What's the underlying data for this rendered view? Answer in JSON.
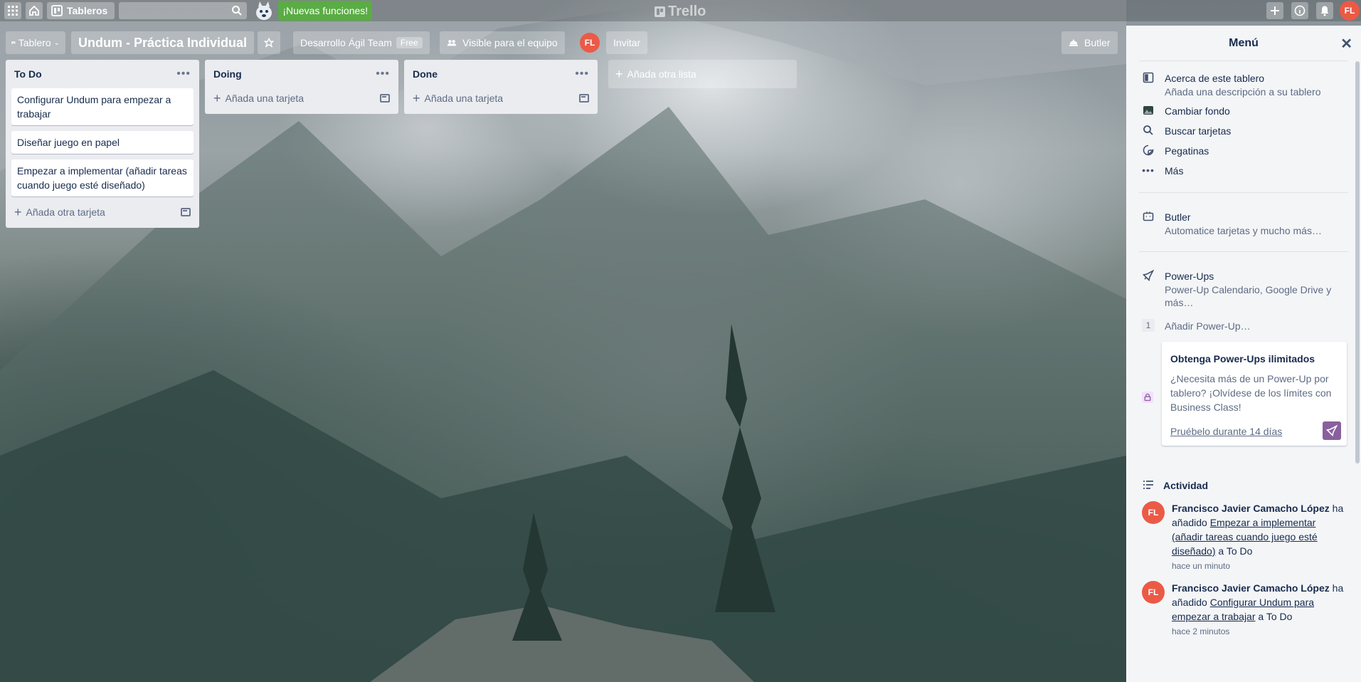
{
  "topbar": {
    "boards_label": "Tableros",
    "new_features": "¡Nuevas funciones!",
    "logo": "Trello",
    "user_initials": "FL"
  },
  "board": {
    "view_label": "Tablero",
    "title": "Undum - Práctica Individual",
    "team": "Desarrollo Ágil Team",
    "team_badge": "Free",
    "visibility": "Visible para el equipo",
    "member_initials": "FL",
    "invite": "Invitar",
    "butler": "Butler"
  },
  "lists": [
    {
      "title": "To Do",
      "cards": [
        "Configurar Undum para empezar a trabajar",
        "Diseñar juego en papel",
        "Empezar a implementar (añadir tareas cuando juego esté diseñado)"
      ],
      "add_label": "Añada otra tarjeta"
    },
    {
      "title": "Doing",
      "cards": [],
      "add_label": "Añada una tarjeta"
    },
    {
      "title": "Done",
      "cards": [],
      "add_label": "Añada una tarjeta"
    }
  ],
  "add_list_label": "Añada otra lista",
  "menu": {
    "title": "Menú",
    "items": [
      {
        "title": "Acerca de este tablero",
        "sub": "Añada una descripción a su tablero"
      },
      {
        "title": "Cambiar fondo"
      },
      {
        "title": "Buscar tarjetas"
      },
      {
        "title": "Pegatinas"
      },
      {
        "title": "Más"
      }
    ],
    "butler": {
      "title": "Butler",
      "sub": "Automatice tarjetas y mucho más…"
    },
    "powerups": {
      "title": "Power-Ups",
      "sub": "Power-Up Calendario, Google Drive y más…"
    },
    "add_powerup_count": "1",
    "add_powerup": "Añadir Power-Up…",
    "promo": {
      "title": "Obtenga Power-Ups ilimitados",
      "body": "¿Necesita más de un Power-Up por tablero? ¡Olvídese de los límites con Business Class!",
      "link": "Pruébelo durante 14 días"
    },
    "activity_title": "Actividad",
    "activity": [
      {
        "initials": "FL",
        "user": "Francisco Javier Camacho López",
        "verb": " ha añadido ",
        "card": "Empezar a implementar (añadir tareas cuando juego esté diseñado)",
        "dest": " a To Do",
        "time": "hace un minuto"
      },
      {
        "initials": "FL",
        "user": "Francisco Javier Camacho López",
        "verb": " ha añadido ",
        "card": "Configurar Undum para empezar a trabajar",
        "dest": " a To Do",
        "time": "hace 2 minutos"
      }
    ]
  },
  "colors": {
    "accent_green": "#5aac44",
    "avatar_red": "#eb5a46",
    "promo_purple": "#89609e"
  }
}
